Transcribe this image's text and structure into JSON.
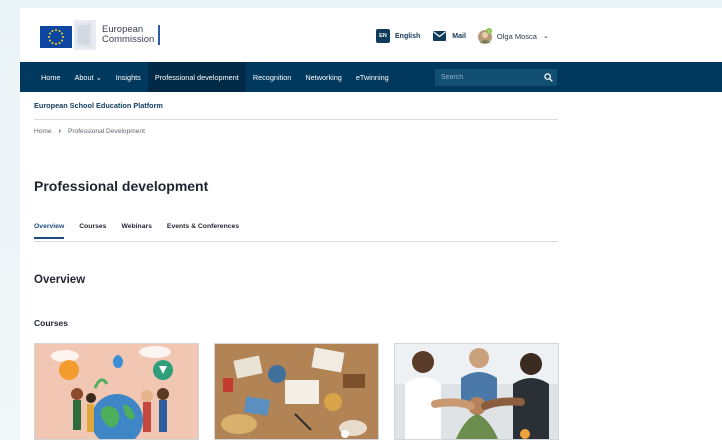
{
  "header": {
    "logo_line1": "European",
    "logo_line2": "Commission",
    "lang_code": "EN",
    "lang_label": "English",
    "mail_label": "Mail",
    "user_name": "Olga Mosca",
    "user_chevron": "⌄"
  },
  "nav": {
    "items": [
      "Home",
      "About ⌄",
      "Insights",
      "Professional development",
      "Recognition",
      "Networking",
      "eTwinning"
    ],
    "active_index": 3,
    "search_placeholder": "Search"
  },
  "platform_name": "European School Education Platform",
  "breadcrumb": {
    "home": "Home",
    "separator": "›",
    "current": "Professional Development"
  },
  "page_title": "Professional development",
  "tabs": {
    "items": [
      "Overview",
      "Courses",
      "Webinars",
      "Events & Conferences"
    ],
    "active_index": 0
  },
  "section_title": "Overview",
  "courses_title": "Courses",
  "colors": {
    "nav_bg": "#00395d",
    "accent": "#1a4c7a",
    "eu_blue": "#0e47a1",
    "eu_yellow": "#ffd617"
  }
}
